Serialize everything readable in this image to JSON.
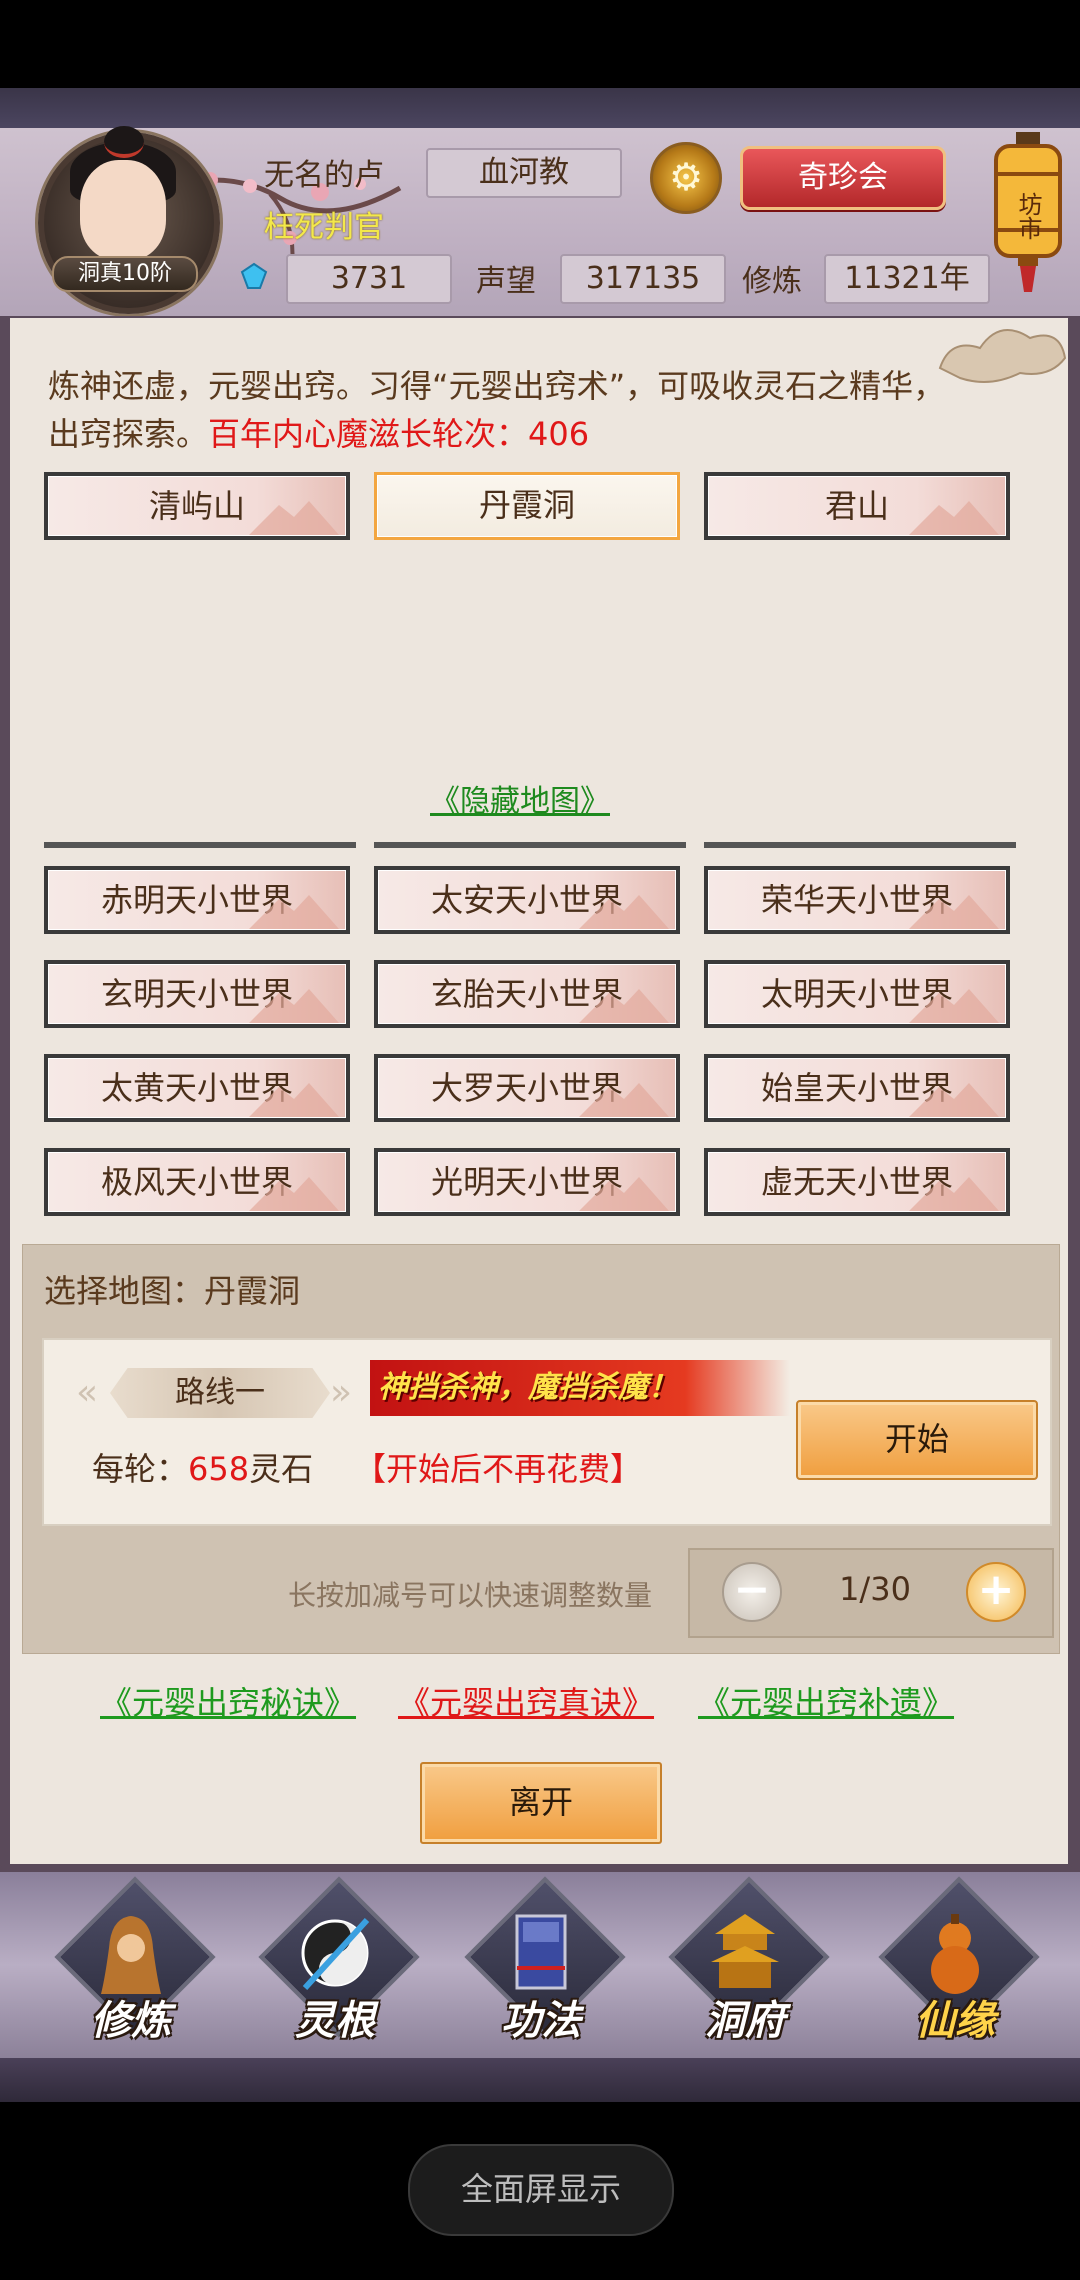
{
  "header": {
    "player_name": "无名的卢",
    "player_title": "枉死判官",
    "rank": "洞真10阶",
    "sect": "血河教",
    "qizhen_label": "奇珍会",
    "fangshi_label": "坊市",
    "lingshi": "3731",
    "shengwang_label": "声望",
    "shengwang": "317135",
    "xiulian_label": "修炼",
    "xiulian": "11321年"
  },
  "panel": {
    "desc_main": "炼神还虚，元婴出窍。习得“元婴出窍术”，可吸收灵石之精华，出窍探索。",
    "desc_red": "百年内心魔滋长轮次：406",
    "maps": [
      "清屿山",
      "丹霞洞",
      "君山"
    ],
    "hidden_map_link": "《隐藏地图》",
    "hidden_maps": [
      [
        "赤明天小世界",
        "太安天小世界",
        "荣华天小世界"
      ],
      [
        "玄明天小世界",
        "玄胎天小世界",
        "太明天小世界"
      ],
      [
        "太黄天小世界",
        "大罗天小世界",
        "始皇天小世界"
      ],
      [
        "极风天小世界",
        "光明天小世界",
        "虚无天小世界"
      ]
    ]
  },
  "selection": {
    "title": "选择地图：丹霞洞",
    "route": "路线一",
    "slogan": "神挡杀神，魔挡杀魔！",
    "cost_prefix": "每轮：",
    "cost_value": "658",
    "cost_unit": "灵石",
    "no_more_cost": "【开始后不再花费】",
    "start_label": "开始",
    "hint": "长按加减号可以快速调整数量",
    "stepper_value": "1/30",
    "minus": "−",
    "plus": "+"
  },
  "books": [
    "《元婴出窍秘诀》",
    "《元婴出窍真诀》",
    "《元婴出窍补遗》"
  ],
  "leave_label": "离开",
  "nav": [
    "修炼",
    "灵根",
    "功法",
    "洞府",
    "仙缘"
  ],
  "fullscreen_label": "全面屏显示",
  "colors": {
    "accent_red": "#e01818",
    "link_green": "#1e9a1e",
    "button_orange": "#f09e3e"
  }
}
